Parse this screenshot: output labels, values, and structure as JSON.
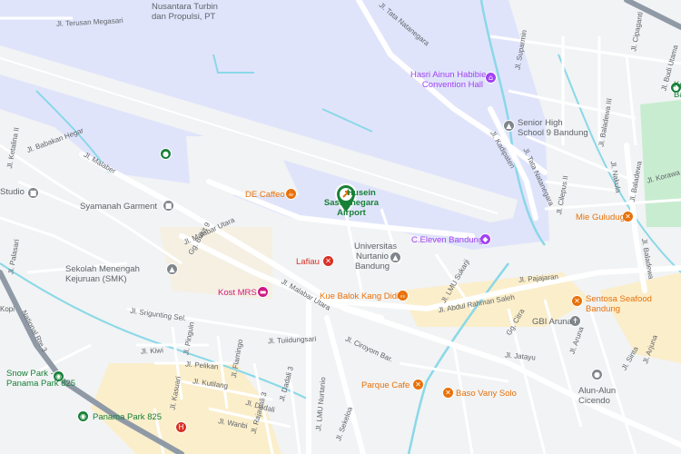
{
  "map": {
    "colors": {
      "land": "#f1f3f4",
      "airport": "#e0e4fb",
      "runway": "#f1f3f4",
      "water": "#8ad8e8",
      "park": "#c8ecd0",
      "commercial": "#fbeecb",
      "road": "#ffffff",
      "highway": "#8f9aa6",
      "text": "#5f6368"
    },
    "airport": {
      "name_line1": "Husein",
      "name_line2": "Sastranegara",
      "name_line3": "Airport",
      "icon": "plane-icon",
      "color": "#188038"
    },
    "places": [
      {
        "id": "nusantara",
        "lines": [
          "Nusantara Turbin",
          "dan Propulsi, PT"
        ],
        "icon": "",
        "color": "#5f6368"
      },
      {
        "id": "hasri",
        "lines": [
          "Hasri Ainun Habibie",
          "Convention Hall"
        ],
        "icon": "hall-icon",
        "color": "#a142f4"
      },
      {
        "id": "senior",
        "lines": [
          "Senior High",
          "School 9 Bandung"
        ],
        "icon": "school-icon",
        "color": "#5f6368"
      },
      {
        "id": "studio",
        "lines": [
          "Studio"
        ],
        "icon": "building-icon",
        "color": "#5f6368"
      },
      {
        "id": "syamanah",
        "lines": [
          "Syamanah Garment"
        ],
        "icon": "building-icon",
        "color": "#5f6368"
      },
      {
        "id": "decaffeo",
        "lines": [
          "DE Caffeo"
        ],
        "icon": "cafe-icon",
        "color": "#e8710a"
      },
      {
        "id": "sekolah",
        "lines": [
          "Sekolah Menengah",
          "Kejuruan (SMK)"
        ],
        "icon": "school-icon",
        "color": "#5f6368"
      },
      {
        "id": "lafiau",
        "lines": [
          "Lafiau"
        ],
        "icon": "restaurant-icon",
        "color": "#d93025"
      },
      {
        "id": "kost",
        "lines": [
          "Kost MRS"
        ],
        "icon": "lodging-icon",
        "color": "#d01884"
      },
      {
        "id": "unnur",
        "lines": [
          "Universitas",
          "Nurtanio",
          "Bandung"
        ],
        "icon": "university-icon",
        "color": "#5f6368"
      },
      {
        "id": "celeven",
        "lines": [
          "C.Eleven Bandung"
        ],
        "icon": "shop-icon",
        "color": "#a142f4"
      },
      {
        "id": "kuebalok",
        "lines": [
          "Kue Balok Kang Didin"
        ],
        "icon": "cafe-icon",
        "color": "#e8710a"
      },
      {
        "id": "mie",
        "lines": [
          "Mie Guludug"
        ],
        "icon": "restaurant-icon",
        "color": "#e8710a"
      },
      {
        "id": "sentosa",
        "lines": [
          "Sentosa Seafood",
          "Bandung"
        ],
        "icon": "restaurant-icon",
        "color": "#e8710a"
      },
      {
        "id": "gbi",
        "lines": [
          "GBI Aruna"
        ],
        "icon": "church-icon",
        "color": "#5f6368"
      },
      {
        "id": "parque",
        "lines": [
          "Parque Cafe"
        ],
        "icon": "restaurant-icon",
        "color": "#e8710a"
      },
      {
        "id": "baso",
        "lines": [
          "Baso Vany Solo"
        ],
        "icon": "restaurant-icon",
        "color": "#e8710a"
      },
      {
        "id": "alun",
        "lines": [
          "Alun-Alun",
          "Cicendo"
        ],
        "icon": "park-icon",
        "color": "#5f6368"
      },
      {
        "id": "snowpark",
        "lines": [
          "Snow Park -",
          "Panama Park 825"
        ],
        "icon": "transit-icon",
        "color": "#188038"
      },
      {
        "id": "panama",
        "lines": [
          "Panama Park 825"
        ],
        "icon": "transit-icon",
        "color": "#188038"
      },
      {
        "id": "hospital",
        "lines": [
          ""
        ],
        "icon": "hospital-icon",
        "color": "#d93025"
      },
      {
        "id": "keb",
        "lines": [
          "Ke",
          "Ba"
        ],
        "icon": "",
        "color": "#188038"
      }
    ],
    "streets": {
      "terusan_megasari": "Jl. Terusan Megasari",
      "tata_natanegara": "Jl. Tata Natanegara",
      "suparmin": "Jl. Suparmin",
      "cipaganti": "Jl. Cipaganti",
      "budi_utama": "Jl. Budi Utama",
      "babakan_hegar": "Jl. Babakan Hegar",
      "ketalina": "Jl. Ketalina II",
      "malaber": "Jl. Malaber",
      "kadipaten": "Jl. Kadipaten",
      "tata_natanegara2": "Jl. Tata Natanegara",
      "baladewa": "Jl. Baladewa",
      "baladewa2": "Jl. Baladewa",
      "korawa": "Jl. Korawa",
      "baladewa_iii": "Jl. Baladewa III",
      "cilepus": "Jl. Cilepus II",
      "nakula": "Jl. Nakula",
      "malabar_utara": "Jl. Malabar Utara",
      "malabar_utara2": "Jl. Malabar Utara",
      "babakan_jawa": "Gg. Bukit 9",
      "palasari": "Jl. Palasari",
      "lmu_sukardi": "Jl. LMU Sukarji",
      "pajajaran": "Jl. Pajajaran",
      "abdul_rahman_saleh": "Jl. Abdul Rahman Saleh",
      "srigunting": "Jl. Srigunting Sel.",
      "kiwi": "Jl. Kiwi",
      "pinguin": "Jl. Pinguin",
      "pelikan": "Jl. Pelikan",
      "flamingo": "Jl. Flamingo",
      "kutilang": "Jl. Kutilang",
      "tuiidungsari": "Jl. Tuiidungsari",
      "ciromon": "Jl. Ciroyom Bar.",
      "citra": "Gg. Citra",
      "aruna": "Jl. Aruna",
      "sinta": "Jl. Sinta",
      "arjuna": "Jl. Arjuna",
      "jatayu": "Jl. Jatayu",
      "dadali": "Jl. Dadali",
      "kasuari": "Jl. Kasuari",
      "wanbi": "Jl. Wanbi",
      "lmu_nurtanio": "Jl. LMU Nurtanio",
      "dadali3": "Jl. Dadali 3",
      "rajawali": "Jl. Rajawali 3",
      "national_route": "National Rte 3",
      "kopi": "Kopi",
      "sekeloa": "Jl. Sekeloa"
    }
  }
}
